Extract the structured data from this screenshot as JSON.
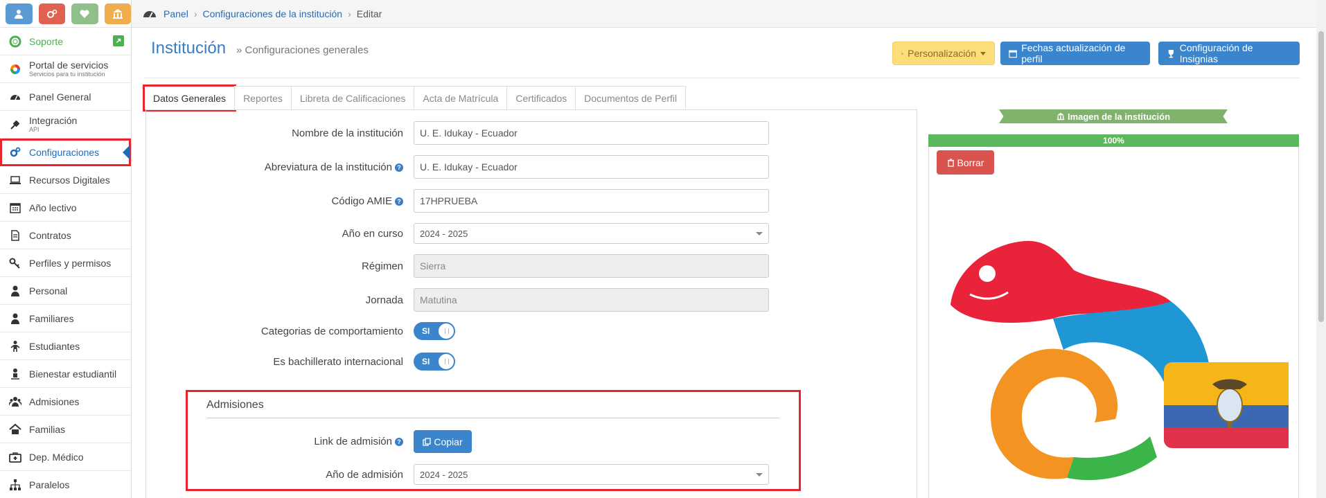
{
  "colors": {
    "accent": "#3a85cc",
    "highlight": "#e8232c",
    "success": "#5cb85c",
    "danger": "#d9534f",
    "warning": "#fddd7a",
    "support": "#4caf50"
  },
  "quick_buttons": [
    {
      "icon": "user-icon",
      "color": "#5b9bd5"
    },
    {
      "icon": "gears-icon",
      "color": "#e0614f"
    },
    {
      "icon": "heartbeat-icon",
      "color": "#8fc08a"
    },
    {
      "icon": "bank-icon",
      "color": "#f0ad4e"
    }
  ],
  "sidebar": {
    "support": "Soporte",
    "portal": {
      "label": "Portal de servicios",
      "sub": "Servicios para tu institución"
    },
    "items": [
      {
        "label": "Panel General",
        "icon": "dashboard-icon"
      },
      {
        "label": "Integración",
        "sub": "API",
        "icon": "plug-icon"
      },
      {
        "label": "Configuraciones",
        "icon": "cogs-icon",
        "active": true
      },
      {
        "label": "Recursos Digitales",
        "icon": "laptop-icon"
      },
      {
        "label": "Año lectivo",
        "icon": "calendar-icon"
      },
      {
        "label": "Contratos",
        "icon": "file-icon"
      },
      {
        "label": "Perfiles y permisos",
        "icon": "key-icon"
      },
      {
        "label": "Personal",
        "icon": "user-icon"
      },
      {
        "label": "Familiares",
        "icon": "user-icon"
      },
      {
        "label": "Estudiantes",
        "icon": "child-icon"
      },
      {
        "label": "Bienestar estudiantil",
        "icon": "user-pin-icon"
      },
      {
        "label": "Admisiones",
        "icon": "users-icon"
      },
      {
        "label": "Familias",
        "icon": "home-icon"
      },
      {
        "label": "Dep. Médico",
        "icon": "medkit-icon"
      },
      {
        "label": "Paralelos",
        "icon": "sitemap-icon"
      }
    ]
  },
  "breadcrumb": {
    "home": "Panel",
    "section": "Configuraciones de la institución",
    "current": "Editar"
  },
  "header": {
    "title": "Institución",
    "subtitle": "» Configuraciones generales",
    "personalizacion": "Personalización",
    "fechas": "Fechas actualización de perfil",
    "insignias": "Configuración de Insignias"
  },
  "tabs": [
    "Datos Generales",
    "Reportes",
    "Libreta de Calificaciones",
    "Acta de Matrícula",
    "Certificados",
    "Documentos de Perfil"
  ],
  "form": {
    "nombre_label": "Nombre de la institución",
    "nombre_value": "U. E. Idukay - Ecuador",
    "abrev_label": "Abreviatura de la institución",
    "abrev_value": "U. E. Idukay - Ecuador",
    "amie_label": "Código AMIE",
    "amie_value": "17HPRUEBA",
    "anio_label": "Año en curso",
    "anio_value": "2024 - 2025",
    "regimen_label": "Régimen",
    "regimen_value": "Sierra",
    "jornada_label": "Jornada",
    "jornada_value": "Matutina",
    "categorias_label": "Categorias de comportamiento",
    "categorias_value": "SI",
    "bachillerato_label": "Es bachillerato internacional",
    "bachillerato_value": "SI"
  },
  "admisiones": {
    "title": "Admisiones",
    "link_label": "Link de admisión",
    "copy_button": "Copiar",
    "anio_label": "Año de admisión",
    "anio_value": "2024 - 2025"
  },
  "image_panel": {
    "ribbon": "Imagen de la institución",
    "progress": "100%",
    "progress_value": 1.0,
    "delete_button": "Borrar"
  }
}
